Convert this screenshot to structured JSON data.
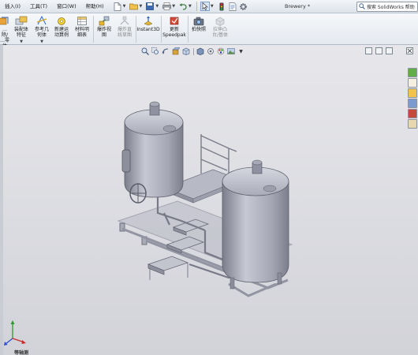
{
  "menubar": {
    "items": [
      "插入",
      "工具",
      "窗口",
      "帮助"
    ],
    "shortcut_keys": [
      "I",
      "T",
      "W",
      "H"
    ]
  },
  "app": {
    "document_title": "Brewery *",
    "search_placeholder": "搜索 SolidWorks 帮助"
  },
  "toolbar": {
    "buttons": [
      {
        "label": "…除/\n…零\n体"
      },
      {
        "label": "装配体\n特征"
      },
      {
        "label": "参考几\n何体"
      },
      {
        "label": "新建运\n动算例"
      },
      {
        "label": "材料明\n细表"
      },
      {
        "label": "爆炸视\n图"
      },
      {
        "label": "爆炸直\n线草图"
      },
      {
        "label": "Instant3D"
      },
      {
        "label": "更新\nSpeedpak"
      },
      {
        "label": "拍快照"
      },
      {
        "label": "拉伸凸\n台/基体"
      }
    ]
  },
  "canvas": {
    "triad_label": "等轴测"
  },
  "colors": {
    "viewport_top": "#e7e7eb",
    "viewport_bottom": "#d2d3d9",
    "model_body": "#a4a6b4",
    "model_highlight": "#c6c8d3",
    "model_shadow": "#7c7e8c"
  }
}
